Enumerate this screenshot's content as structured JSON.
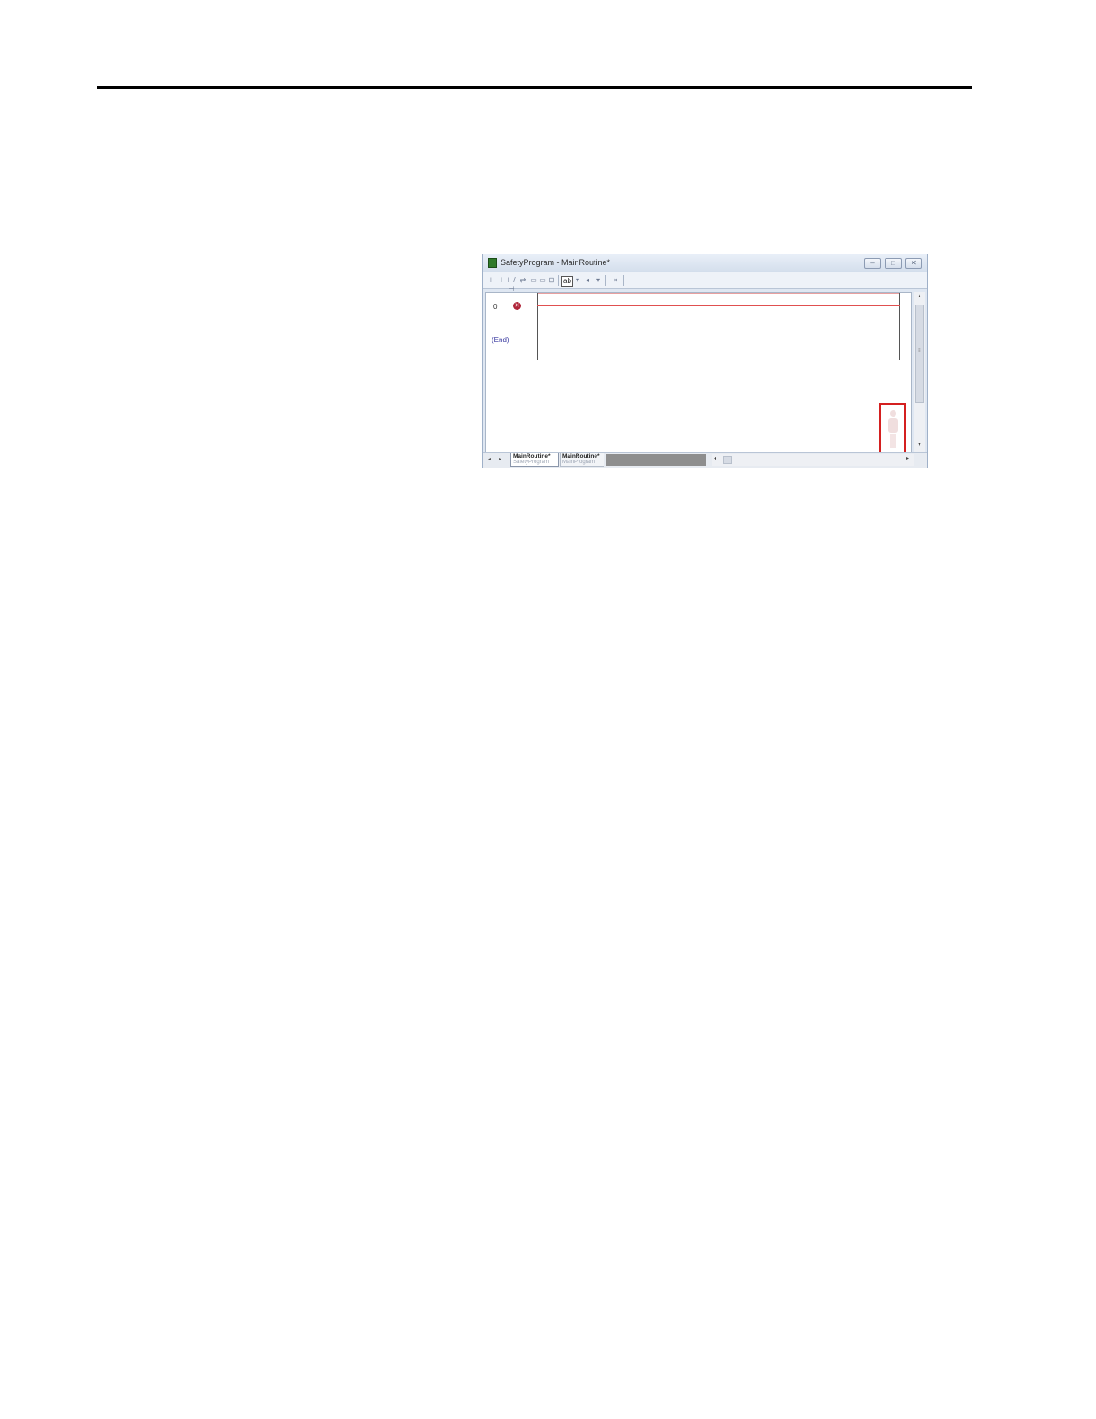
{
  "window": {
    "title": "SafetyProgram - MainRoutine*",
    "buttons": {
      "minimize": "–",
      "restore": "□",
      "close": "✕"
    }
  },
  "toolbar": {
    "items": [
      "⊢⊣",
      "⊢/⊣",
      "⇄",
      "▭",
      "▭",
      "⊟",
      "ab",
      "▾",
      "◂",
      "▾",
      "⇥"
    ]
  },
  "ladder": {
    "rung_number": "0",
    "error_icon": "✕",
    "end_label": "(End)"
  },
  "tabs": [
    {
      "label": "MainRoutine*",
      "program": "SafetyProgram"
    },
    {
      "label": "MainRoutine*",
      "program": "MainProgram"
    }
  ],
  "scroll": {
    "up": "▲",
    "down": "▼",
    "left": "◂",
    "right": "▸",
    "grip": "≡"
  },
  "colors": {
    "highlight": "#d42020",
    "error": "#b0263a",
    "safety_rung": "#e05050"
  }
}
